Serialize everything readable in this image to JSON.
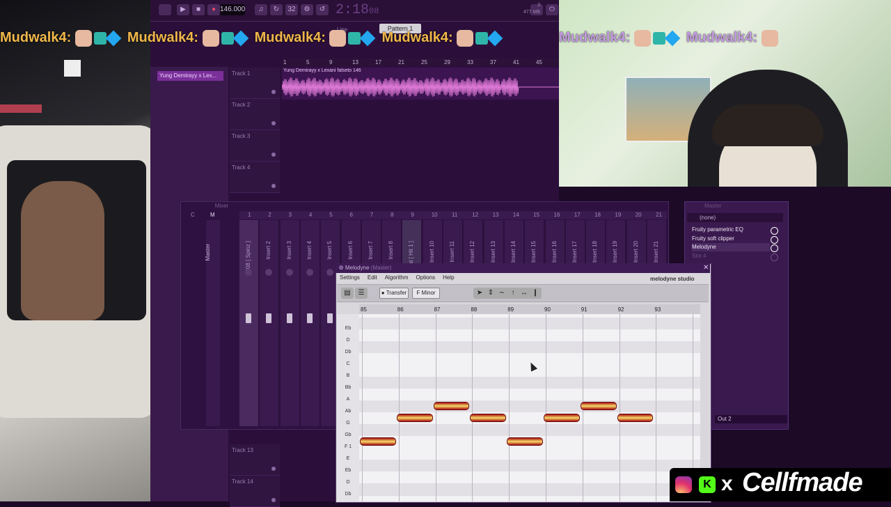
{
  "chat_emote_row": {
    "username": "Mudwalk4:",
    "username_color": "#f0b84a",
    "username_color_right": "#c39be0"
  },
  "toolbar": {
    "tempo": "146.000",
    "time": "2:18",
    "time_suffix": "08",
    "memory": "477 MB",
    "memory_value": "3",
    "pattern": "Pattern 1",
    "snap_label": "Line"
  },
  "playlist": {
    "clip_list_item": "Yung Demirayy x Lex...",
    "audio_clip_title": "Yung Demirayy x Lexani falseto 146",
    "ruler_marks": [
      "1",
      "5",
      "9",
      "13",
      "17",
      "21",
      "25",
      "29",
      "33",
      "37",
      "41",
      "45"
    ],
    "tracks": [
      "Track 1",
      "Track 2",
      "Track 3",
      "Track 4"
    ],
    "bottom_tracks": [
      "Track 13",
      "Track 14"
    ],
    "waveform_color": "#e07ad8"
  },
  "mixer": {
    "title": "Mixer",
    "master_col_header": "C",
    "master_col_header_2": "M",
    "strip_numbers": [
      "1",
      "2",
      "3",
      "4",
      "5",
      "6",
      "7",
      "8",
      "9",
      "10",
      "11",
      "12",
      "13",
      "14",
      "15",
      "16",
      "17",
      "18",
      "19",
      "20",
      "21"
    ],
    "master_label": "Master",
    "strips": [
      "808 [ Spinz ]",
      "Insert 2",
      "Insert 3",
      "Insert 4",
      "Insert 5",
      "Insert 6",
      "Insert 7",
      "Insert 8",
      "Hat [ Hit 1 ]",
      "Insert 10",
      "Insert 11",
      "Insert 12",
      "Insert 13",
      "Insert 14",
      "Insert 15",
      "Insert 16",
      "Insert 17",
      "Insert 18",
      "Insert 19",
      "Insert 20",
      "Insert 21"
    ]
  },
  "mixer_fx": {
    "title": "Master",
    "slot_selector": "(none)",
    "slots": [
      "Fruity parametric EQ",
      "Fruity soft clipper",
      "Melodyne",
      "Slot 4"
    ],
    "output": "Out 2"
  },
  "melodyne": {
    "title": "Melodyne",
    "title_suffix": "(Master)",
    "menu": [
      "Settings",
      "Edit",
      "Algorithm",
      "Options",
      "Help"
    ],
    "transfer_label": "Transfer",
    "key_label": "F Minor",
    "logo": "melodyne studio",
    "bars": [
      "85",
      "86",
      "87",
      "88",
      "89",
      "90",
      "91",
      "92",
      "93"
    ],
    "pitch_labels": [
      "Eb",
      "D",
      "Db",
      "C",
      "B",
      "Bb",
      "A",
      "Ab",
      "G",
      "Gb",
      "F 1",
      "E",
      "Eb",
      "D",
      "Db"
    ],
    "notes": [
      {
        "pitch": "F",
        "start_bar": 85.0,
        "end_bar": 86.0
      },
      {
        "pitch": "G",
        "start_bar": 86.0,
        "end_bar": 87.0
      },
      {
        "pitch": "Ab",
        "start_bar": 87.0,
        "end_bar": 88.0
      },
      {
        "pitch": "G",
        "start_bar": 88.0,
        "end_bar": 89.0
      },
      {
        "pitch": "F",
        "start_bar": 89.0,
        "end_bar": 90.0
      },
      {
        "pitch": "G",
        "start_bar": 90.0,
        "end_bar": 91.0
      },
      {
        "pitch": "Ab",
        "start_bar": 91.0,
        "end_bar": 92.0
      },
      {
        "pitch": "G",
        "start_bar": 92.0,
        "end_bar": 93.0
      }
    ]
  },
  "watermark": {
    "separator": "x",
    "name": "Cellfmade",
    "kick_letter": "K"
  }
}
